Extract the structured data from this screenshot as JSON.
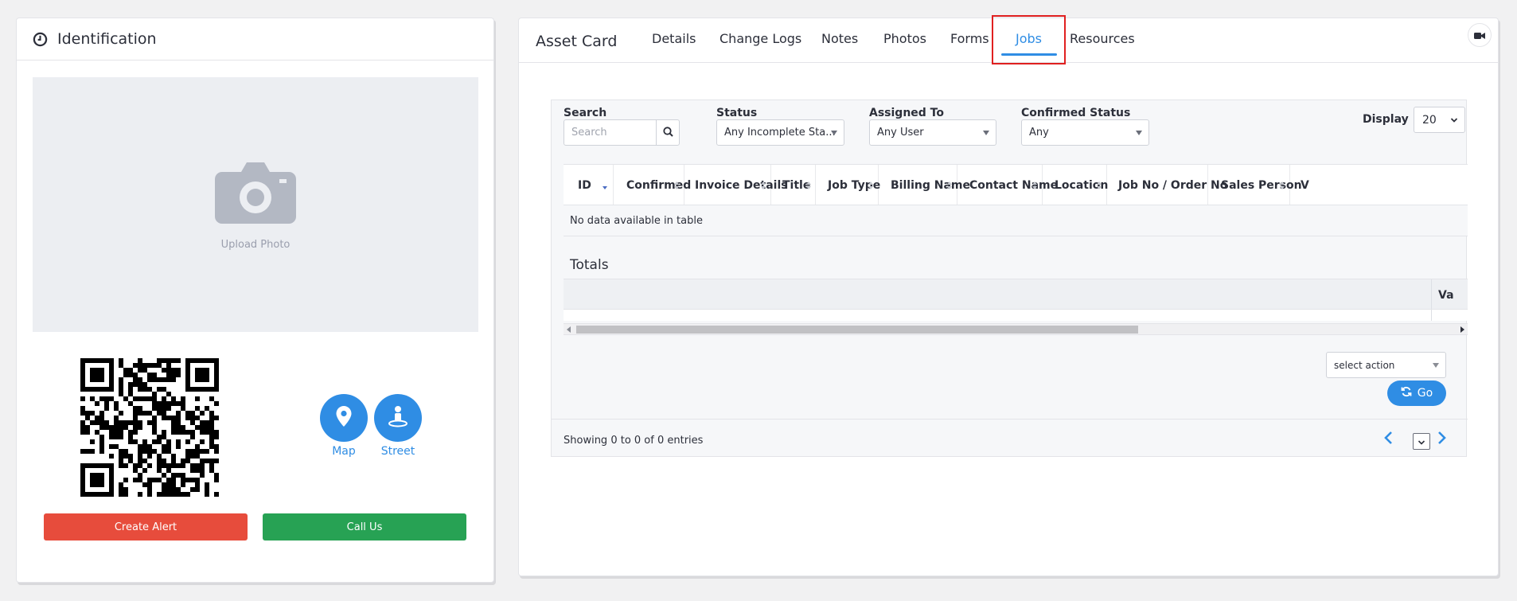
{
  "identification": {
    "title": "Identification",
    "upload_label": "Upload Photo",
    "map_label": "Map",
    "street_label": "Street",
    "create_alert_label": "Create Alert",
    "call_us_label": "Call Us"
  },
  "asset_card": {
    "title": "Asset Card",
    "tabs": [
      {
        "label": "Details",
        "active": false
      },
      {
        "label": "Change Logs",
        "active": false
      },
      {
        "label": "Notes",
        "active": false
      },
      {
        "label": "Photos",
        "active": false
      },
      {
        "label": "Forms",
        "active": false
      },
      {
        "label": "Jobs",
        "active": true
      },
      {
        "label": "Resources",
        "active": false
      }
    ]
  },
  "filters": {
    "search_label": "Search",
    "search_placeholder": "Search",
    "status_label": "Status",
    "status_value": "Any Incomplete Sta...",
    "assigned_label": "Assigned To",
    "assigned_value": "Any User",
    "confirmed_label": "Confirmed Status",
    "confirmed_value": "Any",
    "display_label": "Display",
    "display_value": "20"
  },
  "table": {
    "columns": [
      "ID",
      "Confirmed",
      "Invoice Details",
      "Title",
      "Job Type",
      "Billing Name",
      "Contact Name",
      "Location",
      "Job No / Order No",
      "Sales Person",
      "V"
    ],
    "empty_message": "No data available in table",
    "totals_title": "Totals",
    "totals_column": "Va",
    "select_action": "select action",
    "go_label": "Go",
    "showing": "Showing 0 to 0 of 0 entries"
  },
  "colors": {
    "accent": "#2f8de4",
    "alert": "#e74c3c",
    "call": "#27a254",
    "highlight": "#e02020"
  }
}
